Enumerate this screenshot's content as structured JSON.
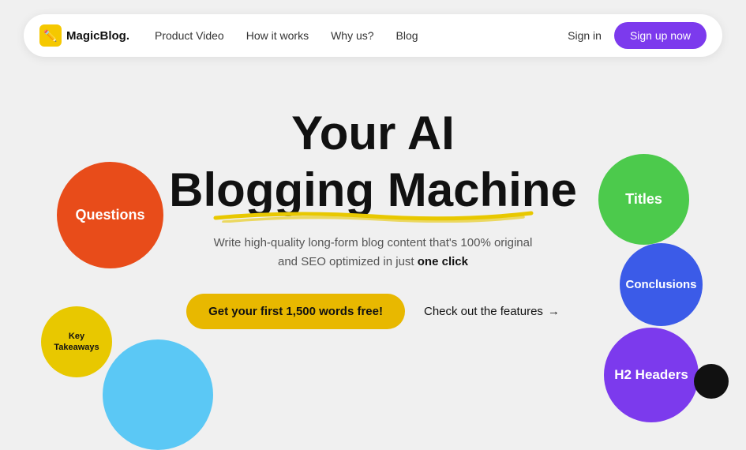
{
  "navbar": {
    "logo_icon": "✏️",
    "logo_text": "MagicBlog.",
    "nav_items": [
      {
        "label": "Product Video"
      },
      {
        "label": "How it works"
      },
      {
        "label": "Why us?"
      },
      {
        "label": "Blog"
      }
    ],
    "sign_in_label": "Sign in",
    "sign_up_label": "Sign up now"
  },
  "hero": {
    "title_line1": "Your AI",
    "title_line2": "Blogging Machine",
    "subtitle_line1": "Write high-quality long-form blog content that's 100% original",
    "subtitle_line2": "and SEO optimized in just ",
    "subtitle_bold": "one click",
    "cta_primary": "Get your first 1,500 words free!",
    "cta_link": "Check out the features",
    "cta_arrow": "→"
  },
  "circles": {
    "questions": "Questions",
    "key_takeaways_line1": "Key",
    "key_takeaways_line2": "Takeaways",
    "titles": "Titles",
    "conclusions": "Conclusions",
    "h2_headers": "H2 Headers"
  },
  "colors": {
    "purple": "#7c3aed",
    "yellow_cta": "#e8b800",
    "red_circle": "#e84c1a",
    "green_circle": "#4cca4c",
    "blue_circle": "#3b5be8",
    "light_blue_circle": "#5bc8f5",
    "purple_circle": "#7c3aed"
  }
}
